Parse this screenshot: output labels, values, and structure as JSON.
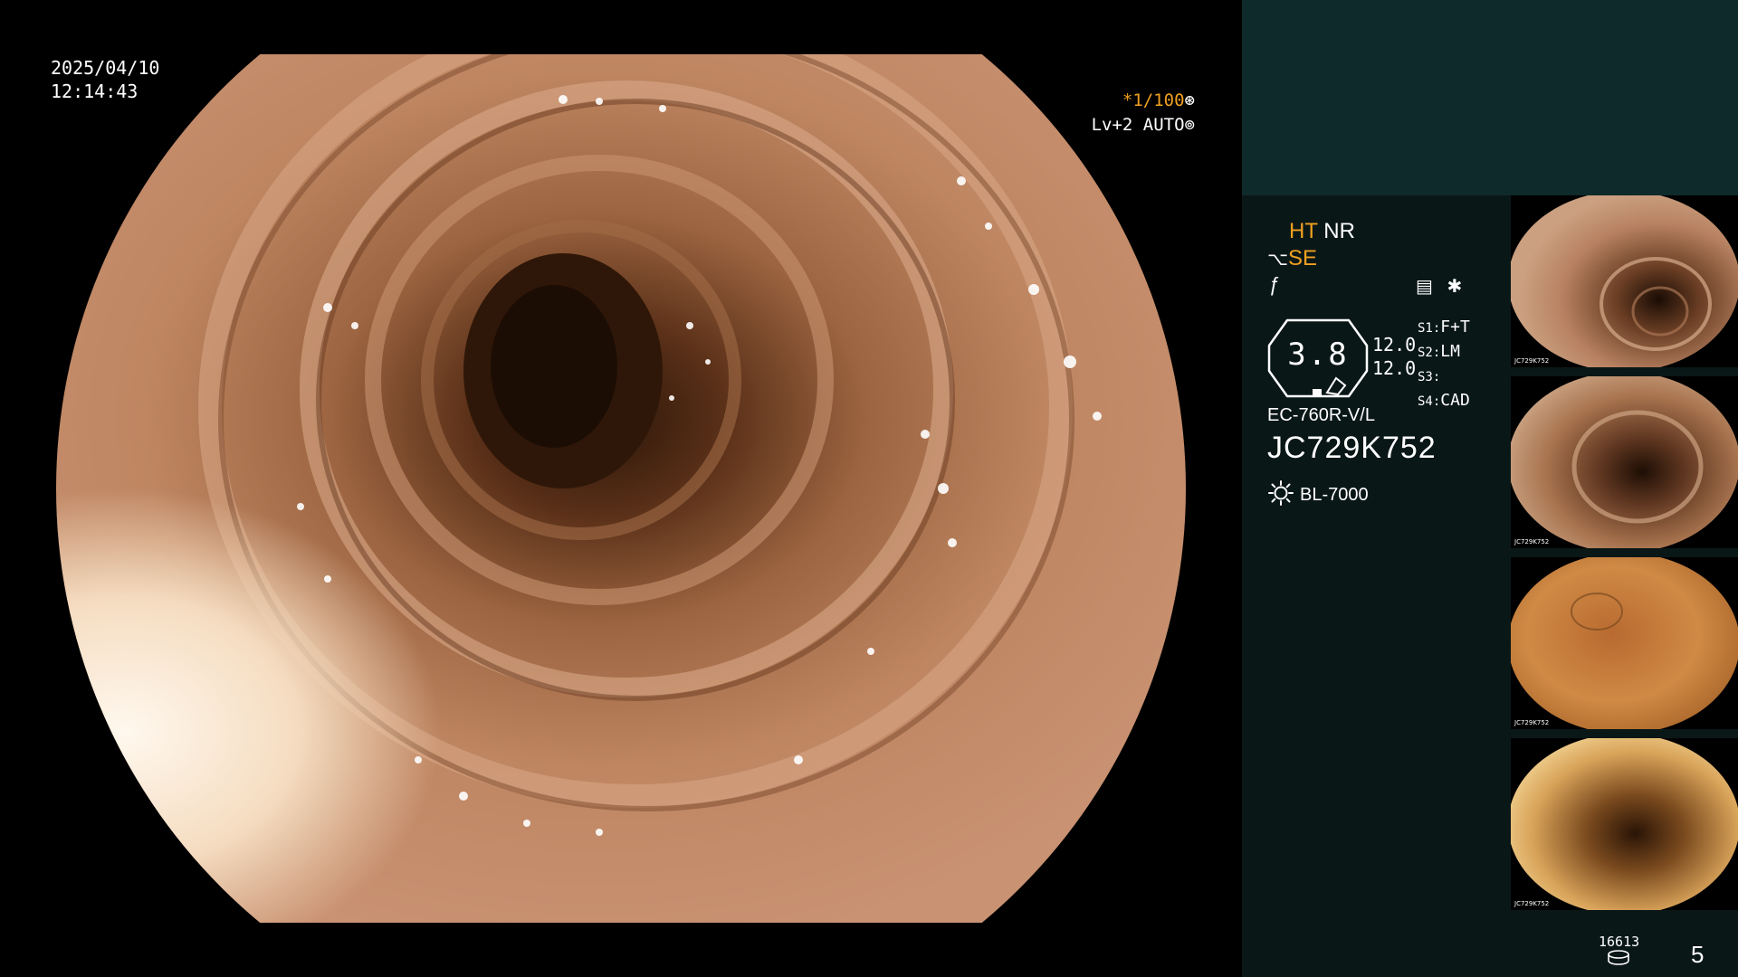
{
  "osd": {
    "date": "2025/04/10",
    "time": "12:14:43",
    "shutter": "*1/100",
    "level": "Lv+2 AUTO"
  },
  "panel": {
    "ht": "HT",
    "nr": "NR",
    "se": "SE",
    "iris_value": "3.8",
    "gain_1": "12.0",
    "gain_2": "12.0",
    "presets": [
      {
        "key": "S1:",
        "value": "F+T"
      },
      {
        "key": "S2:",
        "value": "LM"
      },
      {
        "key": "S3:",
        "value": ""
      },
      {
        "key": "S4:",
        "value": "CAD"
      }
    ],
    "scope_model": "EC-760R-V/L",
    "scope_serial": "JC729K752",
    "light_source": "BL-7000",
    "thumb_serial": "JC729K752"
  },
  "footer": {
    "counter": "16613",
    "page": "5"
  },
  "colors": {
    "accent_orange": "#f0a020",
    "panel_bg": "#0a1717",
    "panel_top_bg": "#0f2a2a"
  }
}
